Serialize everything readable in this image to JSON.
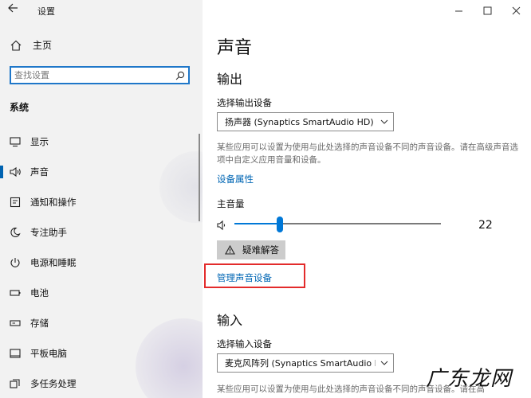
{
  "window": {
    "title": "设置",
    "minimize_icon": "minimize-icon",
    "maximize_icon": "maximize-icon",
    "close_icon": "close-icon"
  },
  "sidebar": {
    "home_label": "主页",
    "search_placeholder": "查找设置",
    "section_title": "系统",
    "items": [
      {
        "icon": "display-icon",
        "label": "显示",
        "active": false
      },
      {
        "icon": "speaker-icon",
        "label": "声音",
        "active": true
      },
      {
        "icon": "notifications-icon",
        "label": "通知和操作",
        "active": false
      },
      {
        "icon": "focus-assist-icon",
        "label": "专注助手",
        "active": false
      },
      {
        "icon": "power-icon",
        "label": "电源和睡眠",
        "active": false
      },
      {
        "icon": "battery-icon",
        "label": "电池",
        "active": false
      },
      {
        "icon": "storage-icon",
        "label": "存储",
        "active": false
      },
      {
        "icon": "tablet-icon",
        "label": "平板电脑",
        "active": false
      },
      {
        "icon": "multitasking-icon",
        "label": "多任务处理",
        "active": false
      }
    ]
  },
  "main": {
    "title": "声音",
    "output": {
      "heading": "输出",
      "device_label": "选择输出设备",
      "device_value": "扬声器 (Synaptics SmartAudio HD)",
      "description": "某些应用可以设置为使用与此处选择的声音设备不同的声音设备。请在高级声音选项中自定义应用音量和设备。",
      "properties_link": "设备属性",
      "volume_label": "主音量",
      "volume_value": "22",
      "troubleshoot_label": "疑难解答",
      "manage_link": "管理声音设备"
    },
    "input": {
      "heading": "输入",
      "device_label": "选择输入设备",
      "device_value": "麦克风阵列 (Synaptics SmartAudio HD)",
      "description": "某些应用可以设置为使用与此处选择的声音设备不同的声音设备。请在高"
    }
  },
  "watermark": "广东龙网",
  "colors": {
    "accent": "#0078d7",
    "link": "#0066b4",
    "highlight_box": "#e32b2b",
    "sidebar_bg": "#f2f2f2"
  }
}
